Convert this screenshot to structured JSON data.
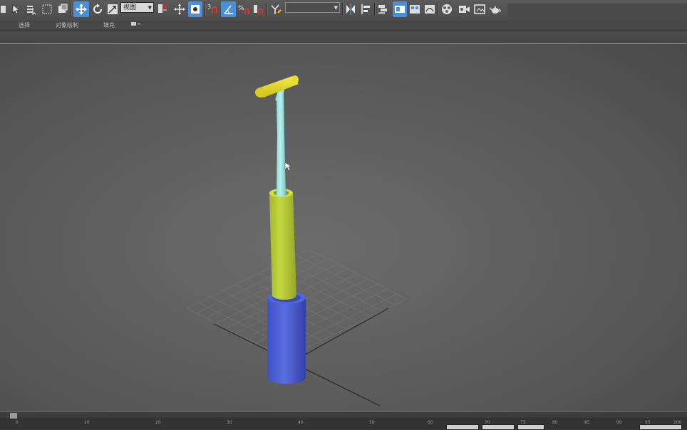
{
  "toolbar": {
    "selection_filter": "",
    "view_ref_coord": "视图",
    "named_selection_set": "",
    "colors": {
      "active": "#4a90d9"
    }
  },
  "ribbon": {
    "tabs": [
      {
        "label": "选择"
      },
      {
        "label": "对象绘制"
      },
      {
        "label": "填充"
      }
    ]
  },
  "viewport": {
    "objects": [
      {
        "name": "base-cylinder",
        "color": "#4f63d6"
      },
      {
        "name": "middle-tube",
        "color": "#bcd23a"
      },
      {
        "name": "inner-rod",
        "color": "#9fe3e3"
      },
      {
        "name": "handle-crossbar",
        "color": "#e6dc2a"
      }
    ]
  },
  "timeline": {
    "ticks": [
      "0",
      "10",
      "20",
      "30",
      "40",
      "50",
      "60",
      "70",
      "75",
      "80",
      "85",
      "90",
      "95",
      "100"
    ]
  },
  "status": {
    "label_a": "",
    "label_b": ""
  }
}
